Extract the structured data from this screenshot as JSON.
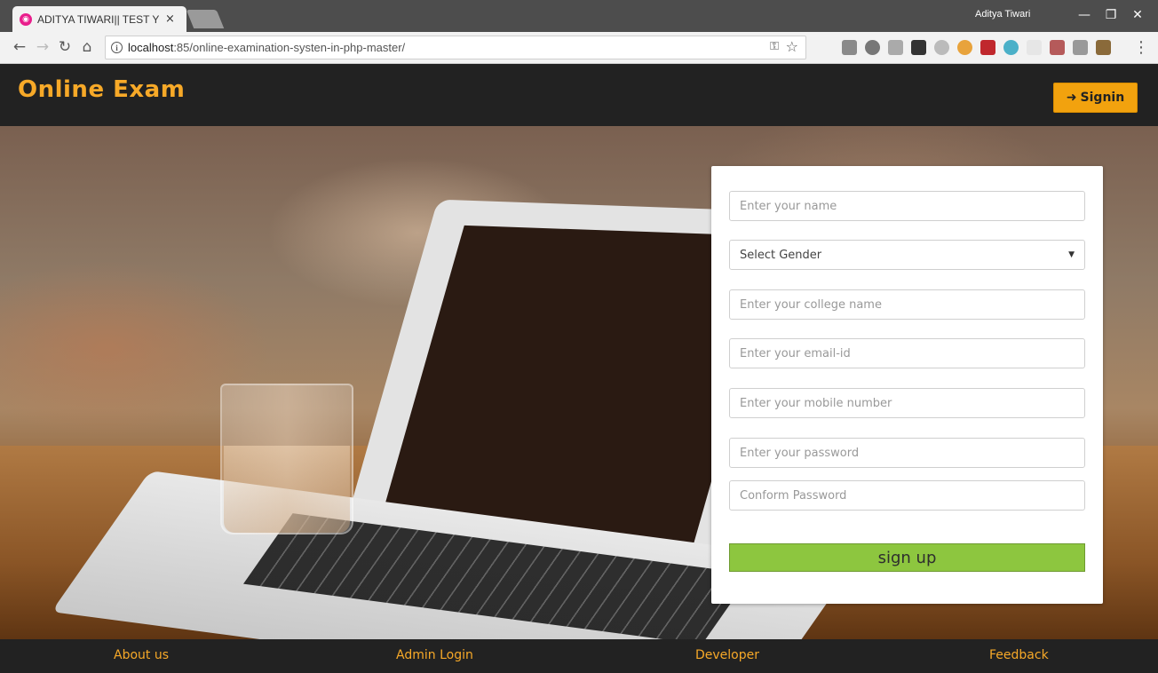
{
  "browser": {
    "tab_title": "ADITYA TIWARI|| TEST YOUR SKILL",
    "tab_close": "×",
    "user_name": "Aditya Tiwari",
    "url_host": "localhost",
    "url_path": ":85/online-examination-systen-in-php-master/"
  },
  "header": {
    "logo": "Online Exam",
    "signin_label": "Signin"
  },
  "form": {
    "name_placeholder": "Enter your name",
    "gender_selected": "Select Gender",
    "college_placeholder": "Enter your college name",
    "email_placeholder": "Enter your email-id",
    "mobile_placeholder": "Enter your mobile number",
    "password_placeholder": "Enter your password",
    "confirm_placeholder": "Conform Password",
    "signup_label": "sign up"
  },
  "footer": {
    "about": "About us",
    "admin": "Admin Login",
    "developer": "Developer",
    "feedback": "Feedback"
  },
  "colors": {
    "accent": "#f7a928",
    "signin_button": "#f2a20e",
    "signup_button": "#8dc63f",
    "header_bg": "#222222"
  }
}
